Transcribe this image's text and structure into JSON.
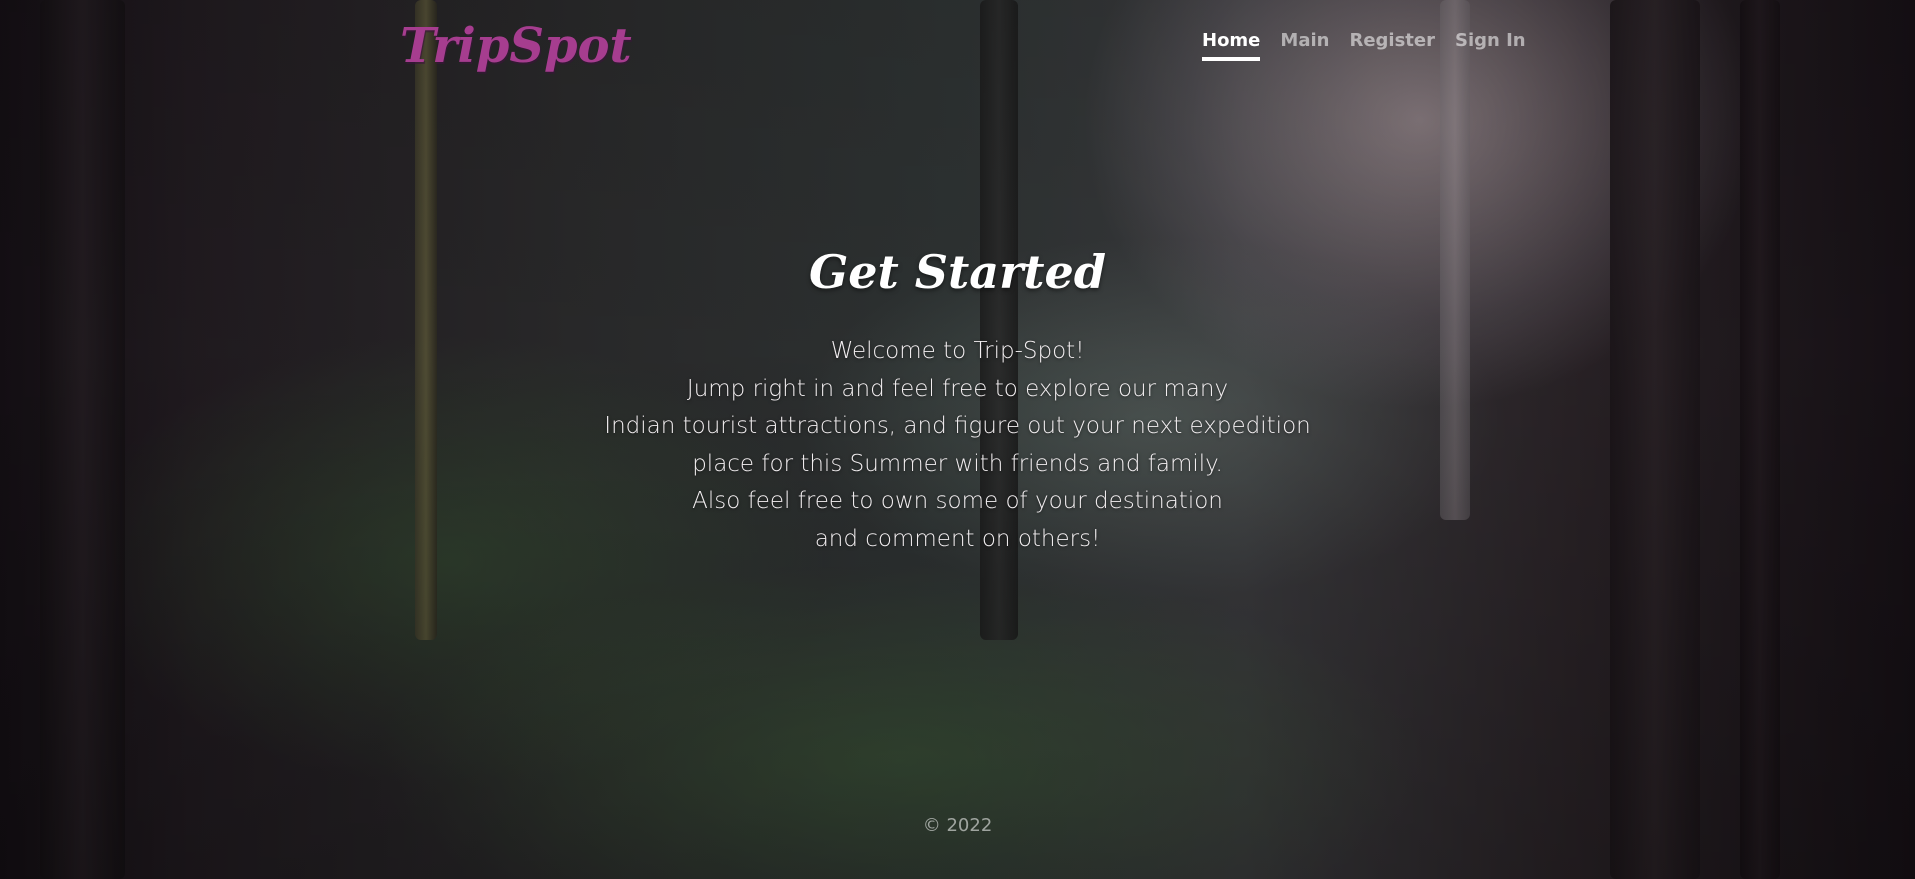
{
  "brand": {
    "name": "TripSpot"
  },
  "nav": {
    "items": [
      {
        "label": "Home",
        "active": true
      },
      {
        "label": "Main",
        "active": false
      },
      {
        "label": "Register",
        "active": false
      },
      {
        "label": "Sign In",
        "active": false
      }
    ]
  },
  "hero": {
    "title": "Get Started",
    "lines": [
      "Welcome to Trip-Spot!",
      "Jump right in and feel free to explore our many",
      "Indian tourist attractions, and figure out your next expedition",
      "place for this Summer with friends and family.",
      "Also feel free to own some of your destination",
      "and comment on others!"
    ]
  },
  "footer": {
    "copyright": "© 2022"
  },
  "colors": {
    "brand": "#a63d8f",
    "nav_active": "#ffffff",
    "nav_inactive": "#9a9598",
    "text": "#f2eef0"
  }
}
